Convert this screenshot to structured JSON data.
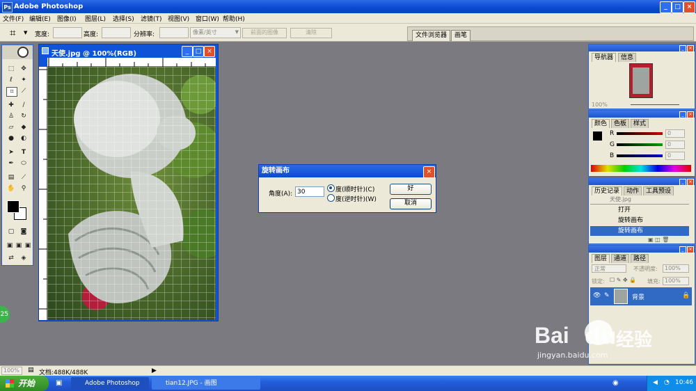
{
  "app": {
    "title": "Adobe Photoshop",
    "logo": "Ps"
  },
  "window_buttons": {
    "minimize": "_",
    "maximize": "□",
    "close": "×"
  },
  "menus": [
    "文件(F)",
    "编辑(E)",
    "图像(I)",
    "图层(L)",
    "选择(S)",
    "滤镜(T)",
    "视图(V)",
    "窗口(W)",
    "帮助(H)"
  ],
  "options_bar": {
    "tool_glyph": "⌗",
    "width_label": "宽度:",
    "height_label": "高度:",
    "resolution_label": "分辨率:",
    "unit_value": "像素/英寸",
    "front_image_btn": "前面的图像",
    "clear_btn": "清除",
    "tabs": [
      "文件浏览器",
      "画笔"
    ]
  },
  "document": {
    "title": "天使.jpg @ 100%(RGB)"
  },
  "dialog": {
    "title": "旋转画布",
    "angle_label": "角度(A):",
    "angle_value": "30",
    "cw_label": "度(顺时针)(C)",
    "ccw_label": "度(逆时针)(W)",
    "ok_btn": "好",
    "cancel_btn": "取消",
    "close_glyph": "×"
  },
  "navigator": {
    "tabs": [
      "导航器",
      "信息"
    ],
    "zoom": "100%"
  },
  "color": {
    "tabs": [
      "颜色",
      "色板",
      "样式"
    ],
    "channels": [
      {
        "label": "R",
        "value": "0",
        "color": "#c80000"
      },
      {
        "label": "G",
        "value": "0",
        "color": "#00a000"
      },
      {
        "label": "B",
        "value": "0",
        "color": "#0000c8"
      }
    ]
  },
  "history": {
    "tabs": [
      "历史记录",
      "动作",
      "工具预设"
    ],
    "snapshot": "天使.jpg",
    "items": [
      "打开",
      "旋转画布",
      "旋转画布"
    ],
    "active_index": 2
  },
  "layers": {
    "tabs": [
      "图层",
      "通道",
      "路径"
    ],
    "blend_mode": "正常",
    "opacity_label": "不透明度:",
    "opacity": "100%",
    "lock_label": "锁定:",
    "fill_label": "填充:",
    "fill": "100%",
    "layer_name": "背景"
  },
  "status": {
    "zoom": "100%",
    "doc_info": "文档:488K/488K",
    "arrow": "▶"
  },
  "taskbar": {
    "start": "开始",
    "tasks": [
      "Adobe Photoshop",
      "tian12.JPG - 画图"
    ],
    "clock": "10:46"
  },
  "watermark": {
    "brand": "Bai",
    "brand2": "du",
    "brand3": "经验",
    "url": "jingyan.baidu.com"
  },
  "floating_badge": "25"
}
